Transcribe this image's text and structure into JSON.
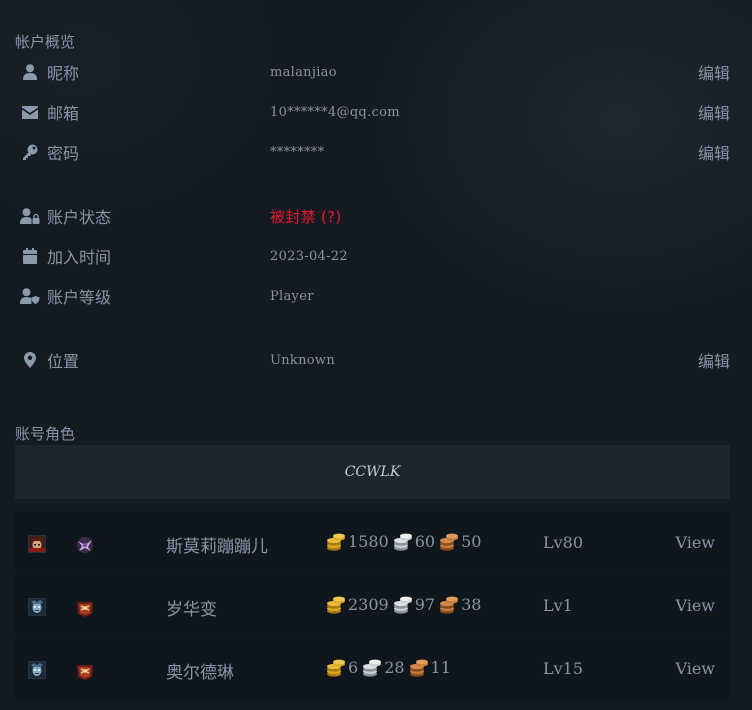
{
  "overview": {
    "title": "帐户概览",
    "rows": [
      {
        "icon": "user-icon",
        "label": "昵称",
        "value": "malanjiao",
        "edit": "编辑"
      },
      {
        "icon": "mail-icon",
        "label": "邮箱",
        "value": "10******4@qq.com",
        "edit": "编辑"
      },
      {
        "icon": "key-icon",
        "label": "密码",
        "value": "********",
        "edit": "编辑"
      },
      {
        "icon": "user-lock-icon",
        "label": "账户状态",
        "value": "被封禁 (?)"
      },
      {
        "icon": "calendar-icon",
        "label": "加入时间",
        "value": "2023-04-22"
      },
      {
        "icon": "user-shield-icon",
        "label": "账户等级",
        "value": "Player"
      },
      {
        "icon": "location-pin-icon",
        "label": "位置",
        "value": "Unknown",
        "edit": "编辑"
      }
    ]
  },
  "characters": {
    "title": "账号角色",
    "realm": "CCWLK",
    "list": [
      {
        "race_icon": "human-race-icon",
        "class_icon": "warlock-class-icon",
        "name": "斯莫莉蹦蹦儿",
        "gold": "1580",
        "silver": "60",
        "copper": "50",
        "level": "Lv80",
        "view": "View"
      },
      {
        "race_icon": "undead-race-icon",
        "class_icon": "warrior-class-icon",
        "name": "岁华变",
        "gold": "2309",
        "silver": "97",
        "copper": "38",
        "level": "Lv1",
        "view": "View"
      },
      {
        "race_icon": "undead-race-icon",
        "class_icon": "warrior-class-icon",
        "name": "奥尔德琳",
        "gold": "6",
        "silver": "28",
        "copper": "11",
        "level": "Lv15",
        "view": "View"
      }
    ]
  },
  "colors": {
    "background": "#131a22",
    "text": "#8796a6",
    "banned": "#e8192c",
    "gold": "#d9a826",
    "silver": "#c8ccd0",
    "copper": "#c47a3c"
  }
}
